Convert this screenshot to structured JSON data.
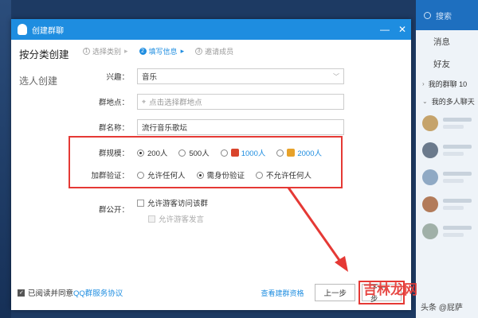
{
  "dialog": {
    "title": "创建群聊",
    "window_buttons": {
      "minimize": "—",
      "close": "✕"
    }
  },
  "sidebar": {
    "items": [
      {
        "label": "按分类创建",
        "active": true
      },
      {
        "label": "选人创建",
        "active": false
      }
    ]
  },
  "steps": [
    {
      "num": "1",
      "label": "选择类别",
      "active": false
    },
    {
      "num": "2",
      "label": "填写信息",
      "active": true
    },
    {
      "num": "3",
      "label": "邀请成员",
      "active": false
    }
  ],
  "form": {
    "interest": {
      "label": "兴趣：",
      "value": "音乐"
    },
    "location": {
      "label": "群地点：",
      "placeholder": "点击选择群地点"
    },
    "name": {
      "label": "群名称：",
      "value": "流行音乐歌坛"
    },
    "scale": {
      "label": "群规模：",
      "options": [
        {
          "label": "200人",
          "selected": true,
          "vip": null
        },
        {
          "label": "500人",
          "selected": false,
          "vip": null
        },
        {
          "label": "1000人",
          "selected": false,
          "vip": "red"
        },
        {
          "label": "2000人",
          "selected": false,
          "vip": "gold"
        }
      ]
    },
    "verify": {
      "label": "加群验证：",
      "options": [
        {
          "label": "允许任何人",
          "selected": false
        },
        {
          "label": "需身份验证",
          "selected": true
        },
        {
          "label": "不允许任何人",
          "selected": false
        }
      ]
    },
    "public": {
      "label": "群公开：",
      "options": [
        {
          "label": "允许游客访问该群",
          "checked": false,
          "disabled": false
        },
        {
          "label": "允许游客发言",
          "checked": false,
          "disabled": true
        }
      ]
    }
  },
  "footer": {
    "agree_prefix": "已阅读并同意",
    "agree_link": "QQ群服务协议",
    "agree_checked": true,
    "view_qualification": "查看建群资格",
    "prev": "上一步",
    "next": "下一步"
  },
  "qq_panel": {
    "search_placeholder": "搜索",
    "tab_messages": "消息",
    "tab_friends": "好友",
    "group_row_1": "我的群聊 10",
    "group_row_2": "我的多人聊天"
  },
  "watermark": {
    "main": "吉林龙网",
    "sub": "头条 @屁萨"
  },
  "colors": {
    "accent": "#1e8de0",
    "highlight_red": "#e53935"
  }
}
